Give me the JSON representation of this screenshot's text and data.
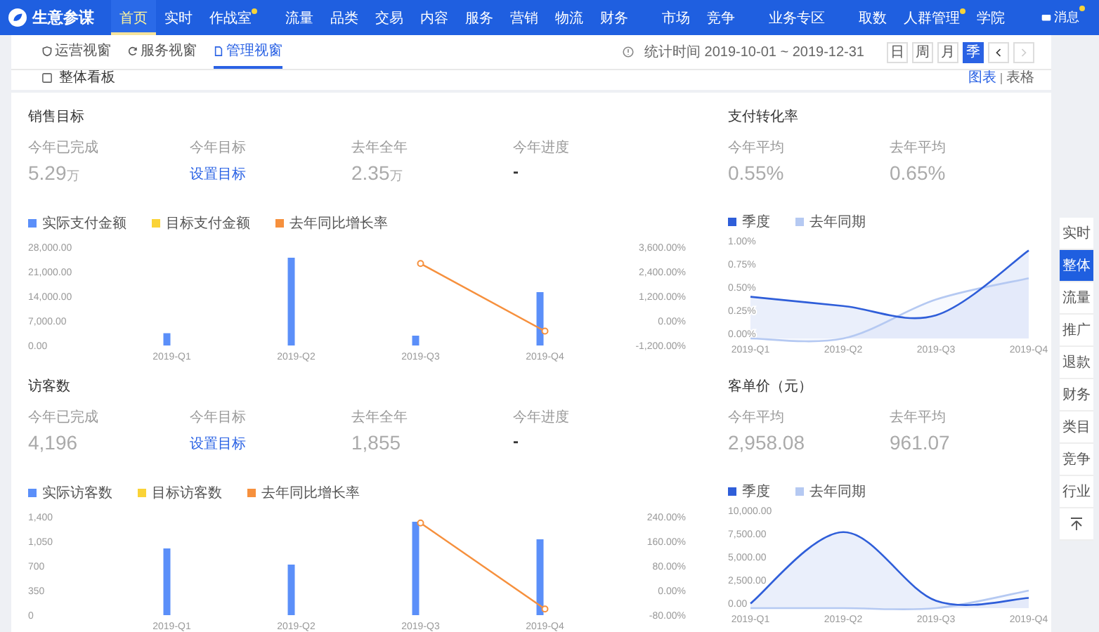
{
  "app": {
    "name": "生意参谋"
  },
  "nav_groups": [
    {
      "items": [
        {
          "label": "首页",
          "selected": true,
          "dot": false
        },
        {
          "label": "实时",
          "selected": false,
          "dot": false
        },
        {
          "label": "作战室",
          "selected": false,
          "dot": true
        }
      ]
    },
    {
      "items": [
        {
          "label": "流量",
          "selected": false,
          "dot": false
        },
        {
          "label": "品类",
          "selected": false,
          "dot": false
        },
        {
          "label": "交易",
          "selected": false,
          "dot": false
        },
        {
          "label": "内容",
          "selected": false,
          "dot": false
        },
        {
          "label": "服务",
          "selected": false,
          "dot": false
        },
        {
          "label": "营销",
          "selected": false,
          "dot": false
        },
        {
          "label": "物流",
          "selected": false,
          "dot": false
        },
        {
          "label": "财务",
          "selected": false,
          "dot": false
        }
      ]
    },
    {
      "items": [
        {
          "label": "市场",
          "selected": false,
          "dot": false
        },
        {
          "label": "竞争",
          "selected": false,
          "dot": false
        }
      ]
    },
    {
      "items": [
        {
          "label": "业务专区",
          "selected": false,
          "dot": false
        }
      ]
    },
    {
      "items": [
        {
          "label": "取数",
          "selected": false,
          "dot": false
        },
        {
          "label": "人群管理",
          "selected": false,
          "dot": true
        },
        {
          "label": "学院",
          "selected": false,
          "dot": false
        }
      ]
    }
  ],
  "messages": {
    "label": "消息",
    "dot": true
  },
  "view_tabs": [
    {
      "label": "运营视窗",
      "selected": false
    },
    {
      "label": "服务视窗",
      "selected": false
    },
    {
      "label": "管理视窗",
      "selected": true
    }
  ],
  "period": {
    "label": "统计时间 2019-10-01 ~ 2019-12-31",
    "options": [
      {
        "label": "日",
        "selected": false
      },
      {
        "label": "周",
        "selected": false
      },
      {
        "label": "月",
        "selected": false
      },
      {
        "label": "季",
        "selected": true
      }
    ],
    "prev_disabled": false,
    "next_disabled": true
  },
  "board": {
    "title": "整体看板",
    "views": [
      {
        "label": "图表",
        "selected": true
      },
      {
        "label": "表格",
        "selected": false
      }
    ]
  },
  "sections": [
    {
      "title": "销售目标",
      "metrics": [
        {
          "label": "今年已完成",
          "value": "5.29",
          "unit": "万",
          "kind": "number"
        },
        {
          "label": "今年目标",
          "value": "设置目标",
          "kind": "link"
        },
        {
          "label": "去年全年",
          "value": "2.35",
          "unit": "万",
          "kind": "number"
        },
        {
          "label": "今年进度",
          "value": "-",
          "kind": "plain"
        }
      ],
      "chart_data": {
        "type": "bar",
        "categories": [
          "2019-Q1",
          "2019-Q2",
          "2019-Q3",
          "2019-Q4"
        ],
        "series": [
          {
            "name": "实际支付金额",
            "color": "#5b8ff9",
            "values": [
              3500,
              25000,
              2800,
              15200
            ]
          },
          {
            "name": "目标支付金额",
            "color": "#fad337",
            "values": [
              null,
              null,
              null,
              null
            ]
          },
          {
            "name": "去年同比增长率",
            "color": "#f6903d",
            "type": "line",
            "marker": "circle",
            "axis": "y2",
            "values": [
              null,
              null,
              2800,
              -500
            ]
          }
        ],
        "stacked": false,
        "ylim": [
          0,
          28000
        ],
        "y2lim": [
          -1200,
          3600
        ],
        "yticks": [
          {
            "value": 0,
            "label": "0.00"
          },
          {
            "value": 7000,
            "label": "7,000.00"
          },
          {
            "value": 14000,
            "label": "14,000.00"
          },
          {
            "value": 21000,
            "label": "21,000.00"
          },
          {
            "value": 28000,
            "label": "28,000.00"
          }
        ],
        "y2ticks": [
          {
            "value": -1200,
            "label": "-1,200.00%"
          },
          {
            "value": 0,
            "label": "0.00%"
          },
          {
            "value": 1200,
            "label": "1,200.00%"
          },
          {
            "value": 2400,
            "label": "2,400.00%"
          },
          {
            "value": 3600,
            "label": "3,600.00%"
          }
        ]
      }
    },
    {
      "title": "支付转化率",
      "metrics": [
        {
          "label": "今年平均",
          "value": "0.55%",
          "kind": "number"
        },
        {
          "label": "去年平均",
          "value": "0.65%",
          "kind": "number"
        }
      ],
      "chart_data": {
        "type": "area",
        "categories": [
          "2019-Q1",
          "2019-Q2",
          "2019-Q3",
          "2019-Q4"
        ],
        "series": [
          {
            "name": "季度",
            "color": "#2f5ed9",
            "values": [
              0.45,
              0.35,
              0.25,
              0.95
            ]
          },
          {
            "name": "去年同期",
            "color": "#b5c9f2",
            "values": [
              0,
              0,
              0.42,
              0.65
            ]
          }
        ],
        "ylim": [
          0,
          1
        ],
        "yticks": [
          {
            "value": 0,
            "label": "0.00%"
          },
          {
            "value": 0.25,
            "label": "0.25%"
          },
          {
            "value": 0.5,
            "label": "0.50%"
          },
          {
            "value": 0.75,
            "label": "0.75%"
          },
          {
            "value": 1,
            "label": "1.00%"
          }
        ]
      }
    },
    {
      "title": "访客数",
      "metrics": [
        {
          "label": "今年已完成",
          "value": "4,196",
          "kind": "number"
        },
        {
          "label": "今年目标",
          "value": "设置目标",
          "kind": "link"
        },
        {
          "label": "去年全年",
          "value": "1,855",
          "kind": "number"
        },
        {
          "label": "今年进度",
          "value": "-",
          "kind": "plain"
        }
      ],
      "chart_data": {
        "type": "bar",
        "categories": [
          "2019-Q1",
          "2019-Q2",
          "2019-Q3",
          "2019-Q4"
        ],
        "series": [
          {
            "name": "实际访客数",
            "color": "#5b8ff9",
            "values": [
              950,
              720,
              1330,
              1080
            ]
          },
          {
            "name": "目标访客数",
            "color": "#fad337",
            "values": [
              null,
              null,
              null,
              null
            ]
          },
          {
            "name": "去年同比增长率",
            "color": "#f6903d",
            "type": "line",
            "marker": "circle",
            "axis": "y2",
            "values": [
              null,
              null,
              220,
              -60
            ]
          }
        ],
        "stacked": false,
        "ylim": [
          0,
          1400
        ],
        "y2lim": [
          -80,
          240
        ],
        "yticks": [
          {
            "value": 0,
            "label": "0"
          },
          {
            "value": 350,
            "label": "350"
          },
          {
            "value": 700,
            "label": "700"
          },
          {
            "value": 1050,
            "label": "1,050"
          },
          {
            "value": 1400,
            "label": "1,400"
          }
        ],
        "y2ticks": [
          {
            "value": -80,
            "label": "-80.00%"
          },
          {
            "value": 0,
            "label": "0.00%"
          },
          {
            "value": 80,
            "label": "80.00%"
          },
          {
            "value": 160,
            "label": "160.00%"
          },
          {
            "value": 240,
            "label": "240.00%"
          }
        ]
      }
    },
    {
      "title": "客单价（元）",
      "metrics": [
        {
          "label": "今年平均",
          "value": "2,958.08",
          "kind": "number"
        },
        {
          "label": "去年平均",
          "value": "961.07",
          "kind": "number"
        }
      ],
      "chart_data": {
        "type": "area",
        "categories": [
          "2019-Q1",
          "2019-Q2",
          "2019-Q3",
          "2019-Q4"
        ],
        "series": [
          {
            "name": "季度",
            "color": "#2f5ed9",
            "values": [
              500,
              8200,
              800,
              1100
            ]
          },
          {
            "name": "去年同期",
            "color": "#b5c9f2",
            "values": [
              0,
              0,
              0,
              1900
            ]
          }
        ],
        "ylim": [
          0,
          10000
        ],
        "yticks": [
          {
            "value": 0,
            "label": "0.00"
          },
          {
            "value": 2500,
            "label": "2,500.00"
          },
          {
            "value": 5000,
            "label": "5,000.00"
          },
          {
            "value": 7500,
            "label": "7,500.00"
          },
          {
            "value": 10000,
            "label": "10,000.00"
          }
        ]
      }
    }
  ],
  "rail": [
    {
      "label": "实时",
      "selected": false
    },
    {
      "label": "整体",
      "selected": true
    },
    {
      "label": "流量",
      "selected": false
    },
    {
      "label": "推广",
      "selected": false
    },
    {
      "label": "退款",
      "selected": false
    },
    {
      "label": "财务",
      "selected": false
    },
    {
      "label": "类目",
      "selected": false
    },
    {
      "label": "竞争",
      "selected": false
    },
    {
      "label": "行业",
      "selected": false
    }
  ]
}
